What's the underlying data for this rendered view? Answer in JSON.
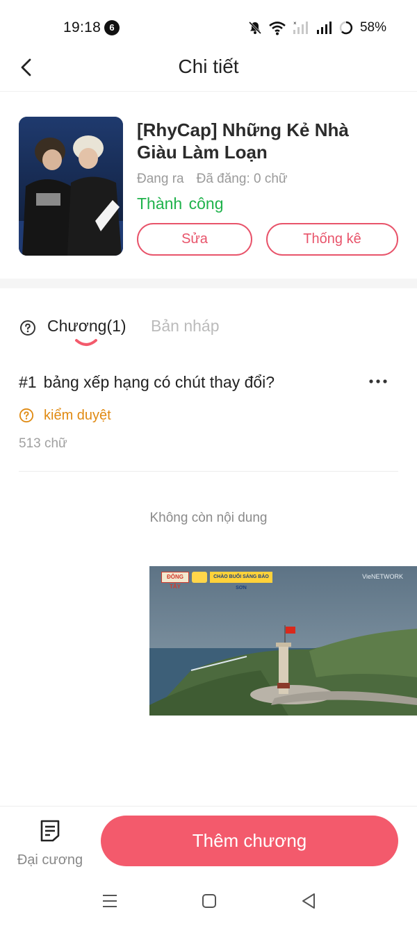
{
  "status_bar": {
    "time": "19:18",
    "notification_count": "6",
    "battery_percent": "58%"
  },
  "header": {
    "title": "Chi tiết"
  },
  "book": {
    "title": "[RhyCap] Những Kẻ Nhà Giàu Làm Loạn",
    "status_ongoing": "Đang ra",
    "published_words": "Đã đăng: 0 chữ",
    "result": "Thành công",
    "edit_label": "Sửa",
    "stats_label": "Thống kê"
  },
  "tabs": {
    "chapters": "Chương(1)",
    "drafts": "Bản nháp"
  },
  "chapters": [
    {
      "number": "#1",
      "title": "bảng xếp hạng có chút thay đổi?",
      "review_status": "kiểm duyệt",
      "word_count": "513 chữ"
    }
  ],
  "list_end": "Không còn nội dung",
  "video": {
    "badge_left": "ĐÔNG TÂY",
    "badge_right": "CHÀO BUỔI SÁNG BẢO SƠN",
    "network": "VieNETWORK"
  },
  "bottom": {
    "outline_label": "Đại cương",
    "add_chapter_label": "Thêm chương"
  },
  "colors": {
    "accent": "#f35a6c",
    "success": "#1fb24b",
    "warning": "#e08a12"
  }
}
